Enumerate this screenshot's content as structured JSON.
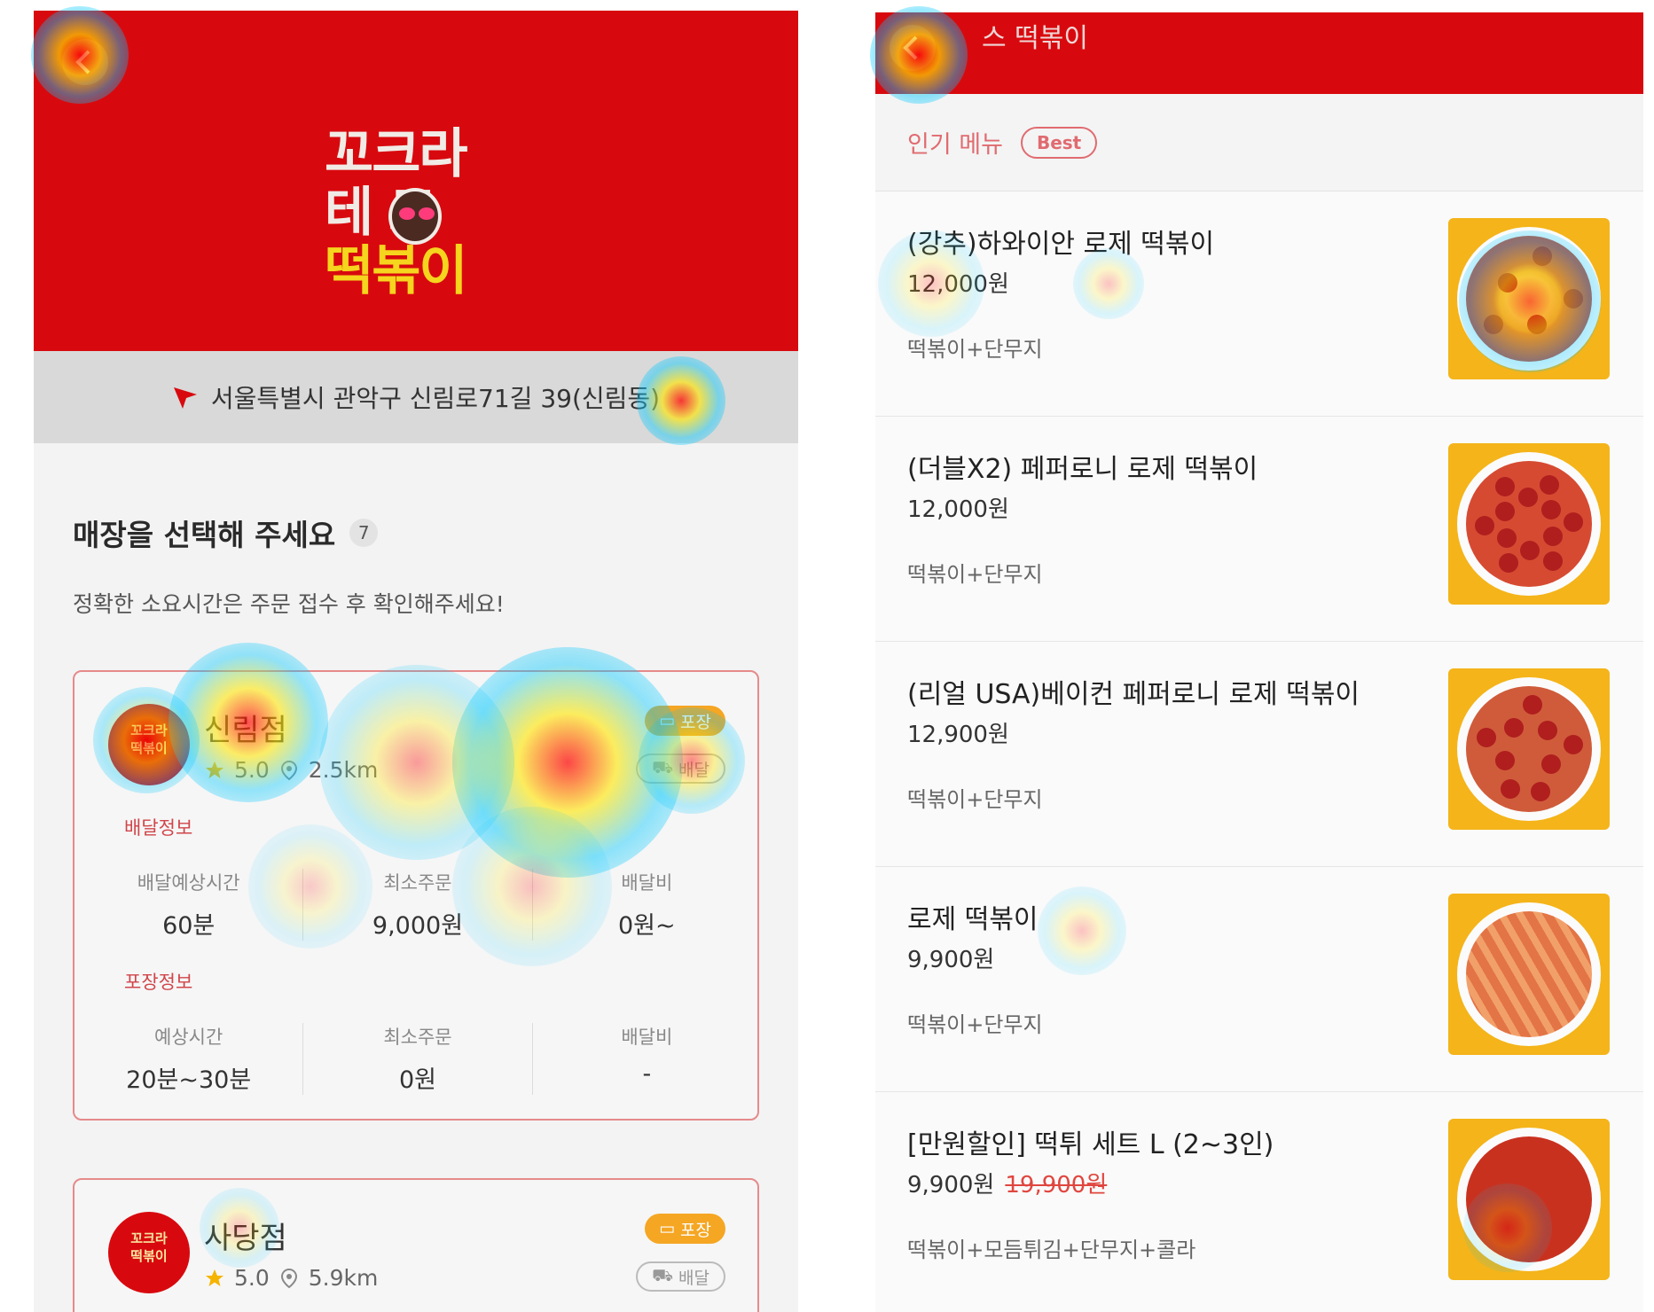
{
  "theme": {
    "brand": "#d8090e",
    "accent": "#f5a623",
    "pickup_badge": "#f5a623"
  },
  "left": {
    "logo": {
      "line1": "꼬크라",
      "line2": "테  드",
      "line3": "떡볶이"
    },
    "address": "서울특별시 관악구 신림로71길 39(신림동)",
    "section_title": "매장을 선택해 주세요",
    "store_count": "7",
    "section_subtitle": "정확한 소요시간은 주문 접수 후 확인해주세요!",
    "stores": [
      {
        "name": "신림점",
        "rating": "5.0",
        "distance": "2.5km",
        "logo_text": "꼬크라\n떡볶이",
        "badge_pickup": "포장",
        "badge_delivery": "배달",
        "delivery_label": "배달정보",
        "delivery": [
          {
            "k": "배달예상시간",
            "v": "60분"
          },
          {
            "k": "최소주문",
            "v": "9,000원"
          },
          {
            "k": "배달비",
            "v": "0원~"
          }
        ],
        "pickup_label": "포장정보",
        "pickup": [
          {
            "k": "예상시간",
            "v": "20분~30분"
          },
          {
            "k": "최소주문",
            "v": "0원"
          },
          {
            "k": "배달비",
            "v": "-"
          }
        ]
      },
      {
        "name": "사당점",
        "rating": "5.0",
        "distance": "5.9km",
        "logo_text": "꼬크라\n떡볶이",
        "badge_pickup": "포장",
        "badge_delivery": "배달"
      }
    ]
  },
  "right": {
    "header_title": "스 떡볶이",
    "popular_title": "인기 메뉴",
    "best_badge": "Best",
    "menu": [
      {
        "name": "(강추)하와이안 로제 떡볶이",
        "price": "12,000원",
        "orig_price": "",
        "desc": "떡볶이+단무지",
        "food": "hawaiian"
      },
      {
        "name": "(더블X2) 페퍼로니 로제 떡볶이",
        "price": "12,000원",
        "orig_price": "",
        "desc": "떡볶이+단무지",
        "food": "pepperoni"
      },
      {
        "name": "(리얼 USA)베이컨 페퍼로니 로제 떡볶이",
        "price": "12,900원",
        "orig_price": "",
        "desc": "떡볶이+단무지",
        "food": "bacon"
      },
      {
        "name": "로제 떡볶이",
        "price": "9,900원",
        "orig_price": "",
        "desc": "떡볶이+단무지",
        "food": "rose"
      },
      {
        "name": "[만원할인] 떡튀 세트 L (2~3인)",
        "price": "9,900원",
        "orig_price": "19,900원",
        "desc": "떡볶이+모듬튀김+단무지+콜라",
        "food": "set"
      }
    ]
  }
}
